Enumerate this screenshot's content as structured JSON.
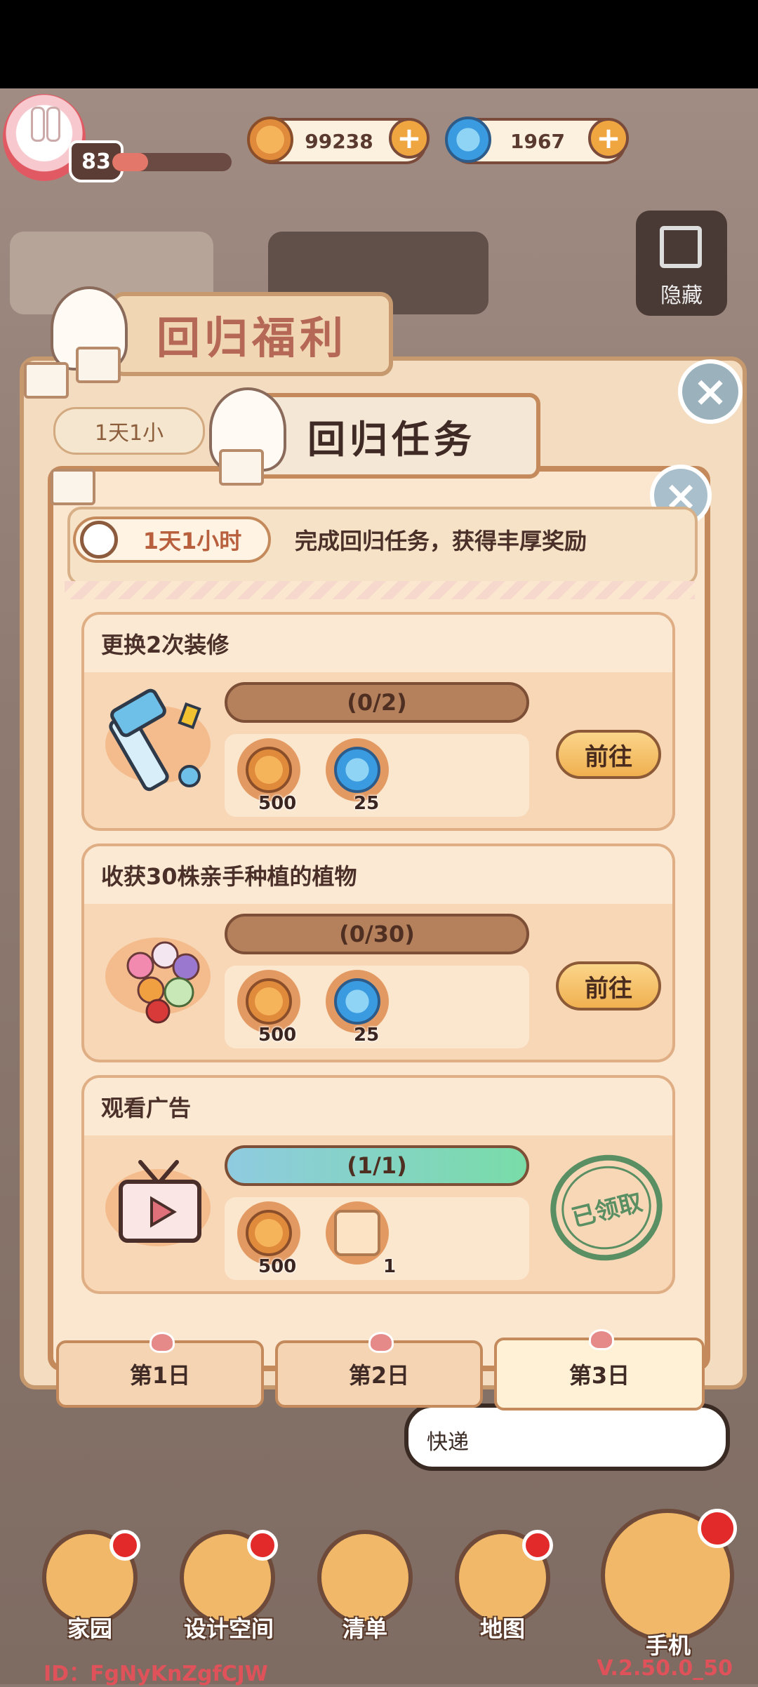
{
  "hud": {
    "level": "83",
    "xp_fraction": 0.3,
    "coins": "99238",
    "gems": "1967",
    "plus_label": "+"
  },
  "hide_button": {
    "label": "隐藏"
  },
  "back_panel": {
    "title": "回归福利",
    "timer": "1天1小",
    "close": "×"
  },
  "main_panel": {
    "title": "回归任务",
    "close": "×",
    "timer": "1天1小时",
    "description": "完成回归任务，获得丰厚奖励"
  },
  "tasks": [
    {
      "title": "更换2次装修",
      "progress_text": "(0/2)",
      "progress_fraction": 0,
      "rewards": [
        {
          "icon": "coin-icon",
          "count": "500"
        },
        {
          "icon": "gem-icon",
          "count": "25"
        }
      ],
      "action": "前往"
    },
    {
      "title": "收获30株亲手种植的植物",
      "progress_text": "(0/30)",
      "progress_fraction": 0,
      "rewards": [
        {
          "icon": "coin-icon",
          "count": "500"
        },
        {
          "icon": "gem-icon",
          "count": "25"
        }
      ],
      "action": "前往"
    },
    {
      "title": "观看广告",
      "progress_text": "(1/1)",
      "progress_fraction": 1,
      "rewards": [
        {
          "icon": "coin-icon",
          "count": "500"
        },
        {
          "icon": "paw-scroll-icon",
          "count": "1"
        }
      ],
      "status": "已领取"
    }
  ],
  "day_tabs": [
    {
      "label": "第1日",
      "active": false
    },
    {
      "label": "第2日",
      "active": false
    },
    {
      "label": "第3日",
      "active": true
    }
  ],
  "bubble": {
    "text": "快递"
  },
  "nav": [
    {
      "label": "家园",
      "icon": "home-icon"
    },
    {
      "label": "设计空间",
      "icon": "design-icon"
    },
    {
      "label": "清单",
      "icon": "list-icon"
    },
    {
      "label": "地图",
      "icon": "map-pin-icon"
    },
    {
      "label": "手机",
      "icon": "phone-icon"
    }
  ],
  "footer": {
    "id": "ID：FgNyKnZgfCJW",
    "version": "V.2.50.0_50"
  },
  "colors": {
    "accent": "#f0b050",
    "panel": "#fbe7cf",
    "border": "#c48a5c",
    "completed_stamp": "#5a8f64",
    "badge_red": "#e22a2a"
  }
}
